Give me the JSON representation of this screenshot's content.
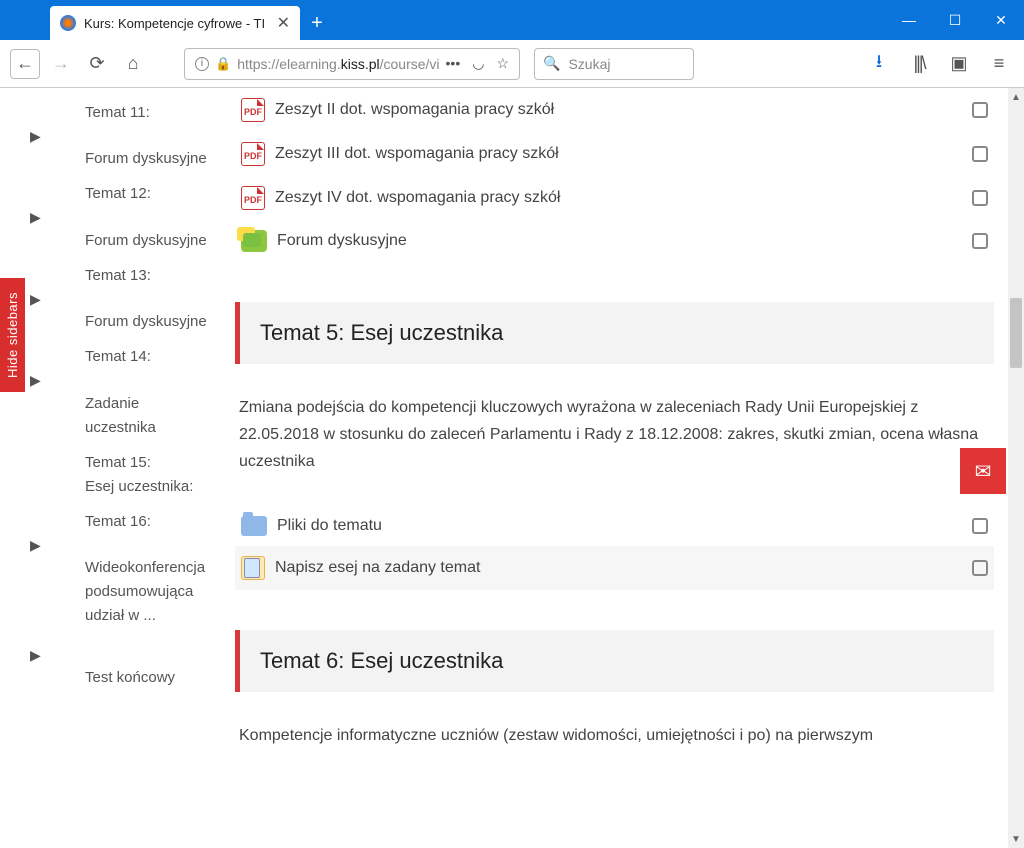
{
  "window": {
    "tab_title": "Kurs: Kompetencje cyfrowe - TI",
    "minimize": "—",
    "maximize": "☐",
    "close": "✕"
  },
  "toolbar": {
    "url_prefix": "https://elearning.",
    "url_host": "kiss.pl",
    "url_path": "/course/vi",
    "search_placeholder": "Szukaj"
  },
  "hide_sidebars_label": "Hide sidebars",
  "sidebar": [
    {
      "title": "Temat 11:",
      "link": "Forum dyskusyjne",
      "arrow": true
    },
    {
      "title": "Temat 12:",
      "link": "Forum dyskusyjne",
      "arrow": true
    },
    {
      "title": "Temat 13:",
      "link": "Forum dyskusyjne",
      "arrow": true
    },
    {
      "title": "Temat 14:",
      "link": "Zadanie uczestnika",
      "arrow": true
    },
    {
      "title": "Temat 15:",
      "link": "Esej uczestnika:",
      "arrow": false
    },
    {
      "title": "Temat 16:",
      "link": "Wideokonferencja podsumowująca udział w ...",
      "arrow": true
    },
    {
      "title": "",
      "link": "Test końcowy",
      "arrow": true
    }
  ],
  "top_activities": [
    {
      "icon": "pdf",
      "label": "Zeszyt II dot. wspomagania pracy szkół"
    },
    {
      "icon": "pdf",
      "label": "Zeszyt III dot. wspomagania pracy szkół"
    },
    {
      "icon": "pdf",
      "label": "Zeszyt IV dot. wspomagania pracy szkół"
    },
    {
      "icon": "forum",
      "label": "Forum dyskusyjne"
    }
  ],
  "section5": {
    "title": "Temat 5: Esej uczestnika",
    "body": "Zmiana podejścia do kompetencji kluczowych wyrażona w zaleceniach Rady Unii Europejskiej z 22.05.2018 w stosunku do zaleceń Parlamentu i Rady z 18.12.2008: zakres, skutki zmian, ocena własna uczestnika",
    "activities": [
      {
        "icon": "folder",
        "label": "Pliki do tematu"
      },
      {
        "icon": "assign",
        "label": "Napisz esej na zadany temat",
        "alt": true
      }
    ]
  },
  "section6": {
    "title": "Temat 6: Esej uczestnika",
    "body": "Kompetencje informatyczne uczniów (zestaw widomości, umiejętności i po) na pierwszym"
  }
}
